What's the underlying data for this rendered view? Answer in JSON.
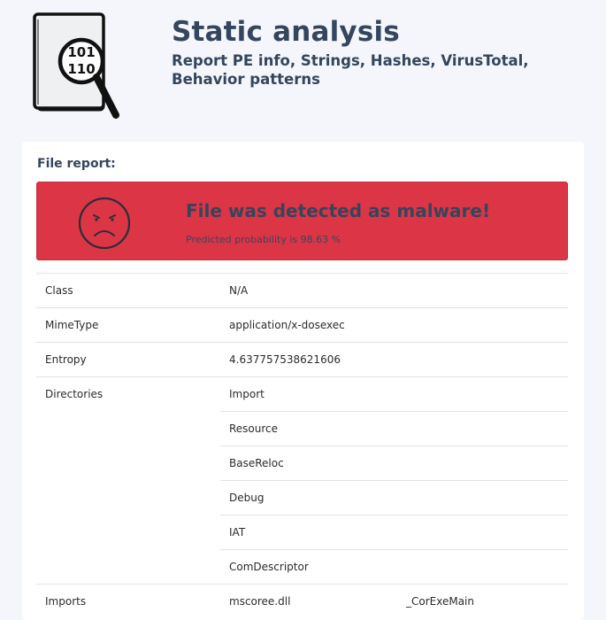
{
  "header": {
    "logo_text_top": "101",
    "logo_text_bottom": "110",
    "title": "Static analysis",
    "subtitle": "Report PE info, Strings, Hashes, VirusTotal, Behavior patterns"
  },
  "card": {
    "title": "File report:",
    "alert": {
      "title": "File was detected as malware!",
      "probability_text": "Predicted probability is 98.63 %",
      "color": "#dc3545"
    },
    "rows": {
      "class": {
        "key": "Class",
        "value": "N/A"
      },
      "mimetype": {
        "key": "MimeType",
        "value": "application/x-dosexec"
      },
      "entropy": {
        "key": "Entropy",
        "value": "4.637757538621606"
      },
      "directories": {
        "key": "Directories",
        "values": [
          "Import",
          "Resource",
          "BaseReloc",
          "Debug",
          "IAT",
          "ComDescriptor"
        ]
      },
      "imports": {
        "key": "Imports",
        "dll": "mscoree.dll",
        "function": "_CorExeMain"
      }
    }
  }
}
